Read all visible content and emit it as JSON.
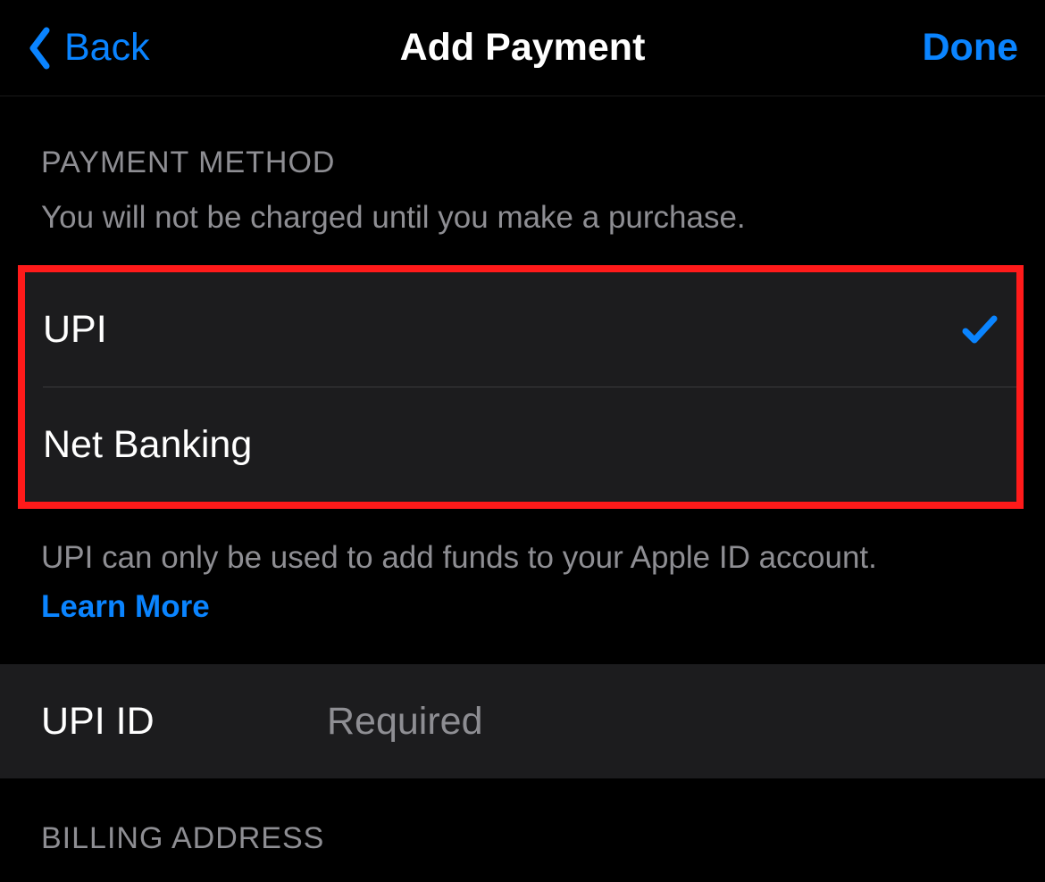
{
  "nav": {
    "back_label": "Back",
    "title": "Add Payment",
    "done_label": "Done"
  },
  "payment_method": {
    "header": "PAYMENT METHOD",
    "subtitle": "You will not be charged until you make a purchase.",
    "options": [
      {
        "label": "UPI",
        "selected": true
      },
      {
        "label": "Net Banking",
        "selected": false
      }
    ],
    "footer_text": "UPI can only be used to add funds to your Apple ID account.",
    "learn_more_label": "Learn More"
  },
  "upi_id": {
    "label": "UPI ID",
    "placeholder": "Required",
    "value": ""
  },
  "billing_address": {
    "header": "BILLING ADDRESS"
  }
}
